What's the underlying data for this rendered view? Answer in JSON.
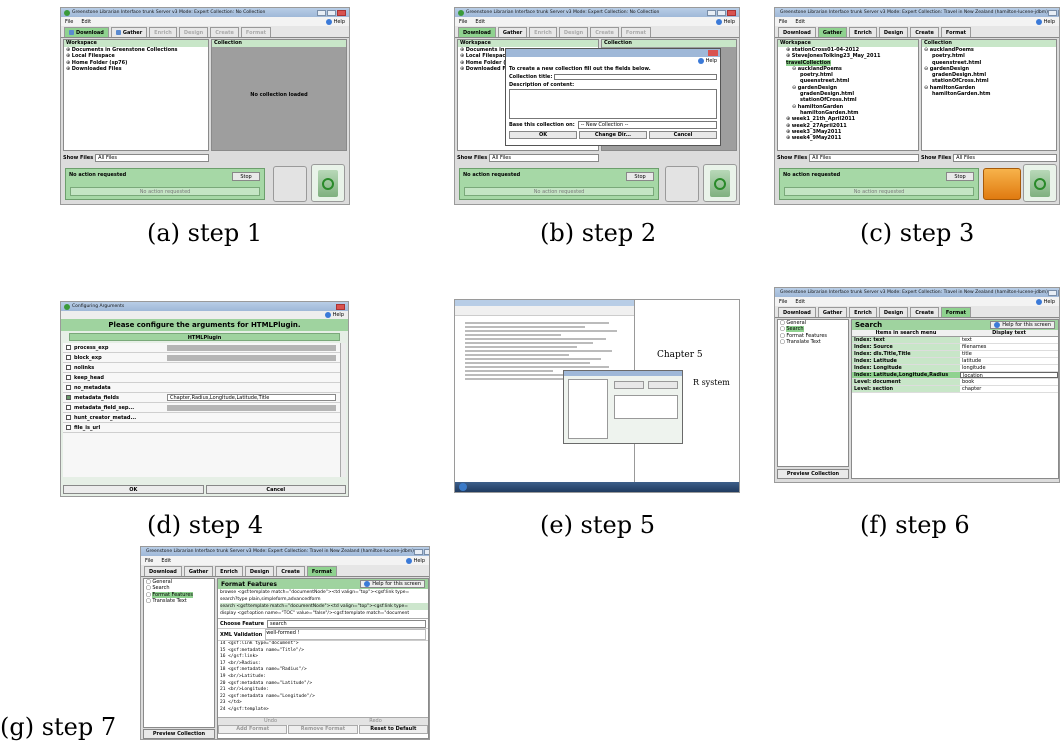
{
  "captions": [
    "(a) step 1",
    "(b) step 2",
    "(c) step 3",
    "(d) step 4",
    "(e) step 5",
    "(f) step 6",
    "(g) step 7"
  ],
  "common": {
    "title_empty": "Greenstone Librarian Interface trunk  Server v3  Mode: Expert  Collection: No Collection",
    "title_travel": "Greenstone Librarian Interface trunk  Server v3  Mode: Expert  Collection: Travel in New Zealand (hamilton-lucene-jdbm)",
    "menu_file": "File",
    "menu_edit": "Edit",
    "help": "Help",
    "tabs": [
      "Download",
      "Gather",
      "Enrich",
      "Design",
      "Create",
      "Format"
    ],
    "workspace": "Workspace",
    "collection": "Collection",
    "show_files_label": "Show Files",
    "show_files_value": "All Files",
    "no_action": "No action requested",
    "stop": "Stop"
  },
  "step1": {
    "workspace_items": [
      "Documents in Greenstone Collections",
      "Local Filespace",
      "Home Folder (sp76)",
      "Downloaded Files"
    ],
    "no_collection": "No collection loaded"
  },
  "step2": {
    "workspace_items": [
      "Documents in",
      "Local Filespac",
      "Home Folder (",
      "Downloaded F"
    ],
    "dialog_help": "Help",
    "dialog_intro": "To create a new collection fill out the fields below.",
    "collection_title_label": "Collection title:",
    "description_label": "Description of content:",
    "base_label": "Base this collection on:",
    "base_value": "-- New Collection --",
    "ok": "OK",
    "change_dir": "Change Dir...",
    "cancel": "Cancel"
  },
  "step3": {
    "workspace_items": [
      "stationCross01-04-2012",
      "SteveJonesTolking23_May_2011",
      "travelCollection",
      "aucklandPoems",
      "poetry.html",
      "queenstreet.html",
      "gardenDesign",
      "gradenDesign.html",
      "stationOfCross.html",
      "hamiltonGarden",
      "hamiltonGarden.htm",
      "week1_21th_April2011",
      "week2_27April2011",
      "week3_3May2011",
      "week4_9May2011"
    ],
    "collection_items": [
      "aucklandPoems",
      "poetry.html",
      "queenstreet.html",
      "gardenDesign",
      "gradenDesign.html",
      "stationOfCross.html",
      "hamiltonGarden",
      "hamiltonGarden.htm"
    ]
  },
  "step4": {
    "window_title": "Configuring Arguments",
    "help": "Help",
    "heading": "Please configure the arguments for HTMLPlugin.",
    "plugin_label": "HTMLPlugin",
    "args": [
      "process_exp",
      "block_exp",
      "nolinks",
      "keep_head",
      "no_metadata",
      "metadata_fields",
      "metadata_field_sep...",
      "hunt_creator_metad...",
      "file_is_url"
    ],
    "metadata_fields_value": "Chapter,Radius,LongItude,Latitude,Title",
    "ok": "OK",
    "cancel": "Cancel"
  },
  "step5": {
    "chapter_heading": "Chapter 5",
    "system_heading": "R system"
  },
  "step6": {
    "left_items": [
      "General",
      "Search",
      "Format Features",
      "Translate Text"
    ],
    "section_title": "Search",
    "help_screen": "Help for this screen",
    "col_items": "Items in search menu",
    "col_display": "Display text",
    "rows": [
      [
        "Index: text",
        "text"
      ],
      [
        "Index: Source",
        "filenames"
      ],
      [
        "Index: dls.Title,Title",
        "title"
      ],
      [
        "Index: Latitude",
        "latitude"
      ],
      [
        "Index: Longitude",
        "longitude"
      ],
      [
        "Index: Latitude,Longitude,Radius",
        "location"
      ],
      [
        "Level: document",
        "book"
      ],
      [
        "Level: section",
        "chapter"
      ]
    ],
    "preview": "Preview Collection"
  },
  "step7": {
    "left_items": [
      "General",
      "Search",
      "Format Features",
      "Translate Text"
    ],
    "section_title": "Format Features",
    "help_screen": "Help for this screen",
    "feature_lines": [
      "browse <gsf:template match=\"documentNode\"><td valign=\"top\"><gsf:link type=",
      "search?type plain,simpleform,advancedform",
      "search <gsf:template match=\"documentNode\"><td valign=\"top\"><gsf:link type=",
      "display <gsf:option name=\"TOC\" value=\"false\"/><gsf:template match=\"document"
    ],
    "choose_label": "Choose Feature",
    "choose_value": "search",
    "xml_label": "XML Validation",
    "xml_value": "well-formed !",
    "code_lines": [
      "14 <gsf:link type=\"document\">",
      "15 <gsf:metadata name=\"Title\"/>",
      "16 </gsf:link>",
      "17 <br/>Radius:",
      "18 <gsf:metadata name=\"Radius\"/>",
      "19 <br/>Latitude:",
      "20 <gsf:metadata name=\"Latitude\"/>",
      "21 <br/>Longitude:",
      "22 <gsf:metadata name=\"Longitude\"/>",
      "23 </td>",
      "24 </gsf:template>"
    ],
    "undo": "Undo",
    "redo": "Redo",
    "preview": "Preview Collection",
    "add_format": "Add Format",
    "remove_format": "Remove Format",
    "reset": "Reset to Default"
  }
}
